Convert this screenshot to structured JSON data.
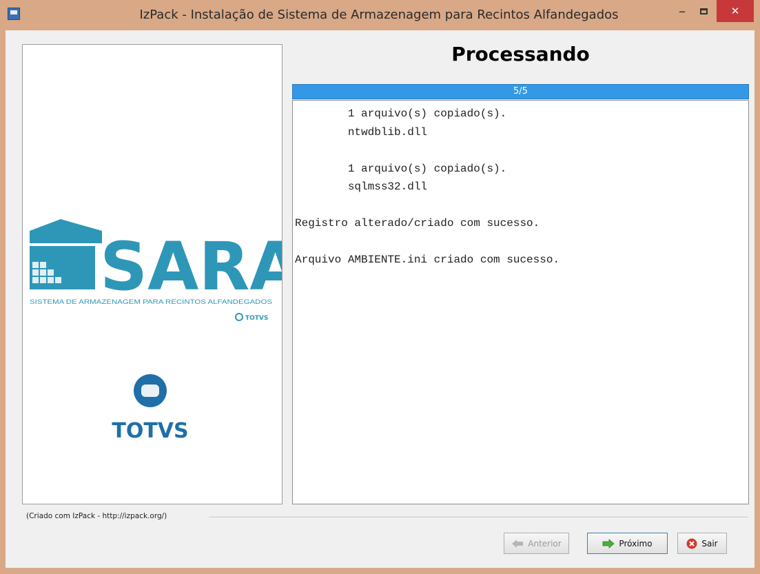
{
  "window": {
    "title": "IzPack - Instalação de Sistema de Armazenagem para Recintos Alfandegados",
    "minimize_label": "–",
    "close_label": "✕"
  },
  "branding": {
    "sara_text": "SARA",
    "sara_tagline": "SISTEMA DE ARMAZENAGEM PARA RECINTOS ALFANDEGADOS",
    "sara_vendor": "TOTVS",
    "totvs_logo_text": "TOTVS",
    "colors": {
      "sara_teal": "#2e97b8",
      "totvs_blue": "#1f6fa8"
    }
  },
  "panel": {
    "heading": "Processando",
    "progress_text": "5/5",
    "progress_value": 1.0
  },
  "log": {
    "text": "        1 arquivo(s) copiado(s).\n        ntwdblib.dll\n\n        1 arquivo(s) copiado(s).\n        sqlmss32.dll\n\nRegistro alterado/criado com sucesso.\n\nArquivo AMBIENTE.ini criado com sucesso."
  },
  "footer": {
    "credit": "(Criado com IzPack - http://izpack.org/)",
    "prev_label": "Anterior",
    "next_label": "Próximo",
    "exit_label": "Sair"
  },
  "colors": {
    "title_bar": "#d8a887",
    "close_button": "#c7383a",
    "progress_bar": "#3399e6"
  }
}
